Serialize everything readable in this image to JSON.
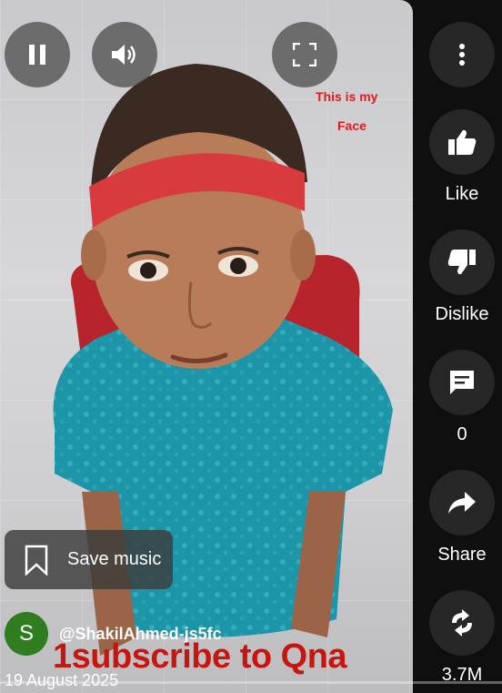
{
  "player": {
    "controls": {
      "pause": "pause-icon",
      "volume": "volume-icon",
      "fullscreen": "fullscreen-icon"
    },
    "overlay_line1": "This is my",
    "overlay_line2": "Face"
  },
  "save_music": {
    "label": "Save music",
    "icon": "bookmark-icon"
  },
  "channel": {
    "avatar_letter": "S",
    "avatar_color": "#2f7d1e",
    "handle": "@ShakilAhmed-js5fc"
  },
  "caption": "1subscribe to Qna",
  "date": "19 August 2025",
  "actions": {
    "more": "more-vert-icon",
    "like": "Like",
    "dislike": "Dislike",
    "comments": "0",
    "share": "Share",
    "remix": "3.7M"
  }
}
